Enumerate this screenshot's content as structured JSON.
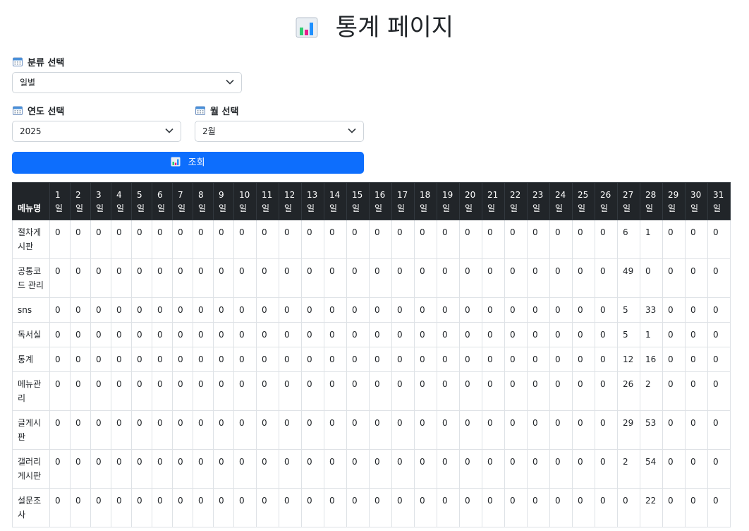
{
  "page_title": "통계 페이지",
  "category_label": "분류 선택",
  "category_value": "일별",
  "year_label": "연도 선택",
  "year_value": "2025",
  "month_label": "월 선택",
  "month_value": "2월",
  "search_button_label": "조회",
  "table": {
    "menu_header": "메뉴명",
    "day_headers": [
      "1 일",
      "2 일",
      "3 일",
      "4 일",
      "5 일",
      "6 일",
      "7 일",
      "8 일",
      "9 일",
      "10 일",
      "11 일",
      "12 일",
      "13 일",
      "14 일",
      "15 일",
      "16 일",
      "17 일",
      "18 일",
      "19 일",
      "20 일",
      "21 일",
      "22 일",
      "23 일",
      "24 일",
      "25 일",
      "26 일",
      "27 일",
      "28 일",
      "29 일",
      "30 일",
      "31 일"
    ],
    "rows": [
      {
        "name": "절차게시판",
        "values": [
          0,
          0,
          0,
          0,
          0,
          0,
          0,
          0,
          0,
          0,
          0,
          0,
          0,
          0,
          0,
          0,
          0,
          0,
          0,
          0,
          0,
          0,
          0,
          0,
          0,
          0,
          6,
          1,
          0,
          0,
          0
        ]
      },
      {
        "name": "공통코드 관리",
        "values": [
          0,
          0,
          0,
          0,
          0,
          0,
          0,
          0,
          0,
          0,
          0,
          0,
          0,
          0,
          0,
          0,
          0,
          0,
          0,
          0,
          0,
          0,
          0,
          0,
          0,
          0,
          49,
          0,
          0,
          0,
          0
        ]
      },
      {
        "name": "sns",
        "values": [
          0,
          0,
          0,
          0,
          0,
          0,
          0,
          0,
          0,
          0,
          0,
          0,
          0,
          0,
          0,
          0,
          0,
          0,
          0,
          0,
          0,
          0,
          0,
          0,
          0,
          0,
          5,
          33,
          0,
          0,
          0
        ]
      },
      {
        "name": "독서실",
        "values": [
          0,
          0,
          0,
          0,
          0,
          0,
          0,
          0,
          0,
          0,
          0,
          0,
          0,
          0,
          0,
          0,
          0,
          0,
          0,
          0,
          0,
          0,
          0,
          0,
          0,
          0,
          5,
          1,
          0,
          0,
          0
        ]
      },
      {
        "name": "통계",
        "values": [
          0,
          0,
          0,
          0,
          0,
          0,
          0,
          0,
          0,
          0,
          0,
          0,
          0,
          0,
          0,
          0,
          0,
          0,
          0,
          0,
          0,
          0,
          0,
          0,
          0,
          0,
          12,
          16,
          0,
          0,
          0
        ]
      },
      {
        "name": "메뉴관리",
        "values": [
          0,
          0,
          0,
          0,
          0,
          0,
          0,
          0,
          0,
          0,
          0,
          0,
          0,
          0,
          0,
          0,
          0,
          0,
          0,
          0,
          0,
          0,
          0,
          0,
          0,
          0,
          26,
          2,
          0,
          0,
          0
        ]
      },
      {
        "name": "글게시판",
        "values": [
          0,
          0,
          0,
          0,
          0,
          0,
          0,
          0,
          0,
          0,
          0,
          0,
          0,
          0,
          0,
          0,
          0,
          0,
          0,
          0,
          0,
          0,
          0,
          0,
          0,
          0,
          29,
          53,
          0,
          0,
          0
        ]
      },
      {
        "name": "갤러리게시판",
        "values": [
          0,
          0,
          0,
          0,
          0,
          0,
          0,
          0,
          0,
          0,
          0,
          0,
          0,
          0,
          0,
          0,
          0,
          0,
          0,
          0,
          0,
          0,
          0,
          0,
          0,
          0,
          2,
          54,
          0,
          0,
          0
        ]
      },
      {
        "name": "설문조사",
        "values": [
          0,
          0,
          0,
          0,
          0,
          0,
          0,
          0,
          0,
          0,
          0,
          0,
          0,
          0,
          0,
          0,
          0,
          0,
          0,
          0,
          0,
          0,
          0,
          0,
          0,
          0,
          0,
          22,
          0,
          0,
          0
        ]
      }
    ]
  },
  "icons": {
    "title": "bar-chart-icon",
    "labels": "calendar-icon",
    "select": "chevron-down-icon"
  },
  "colors": {
    "primary_button": "#0d6efd",
    "table_header": "#212529"
  }
}
